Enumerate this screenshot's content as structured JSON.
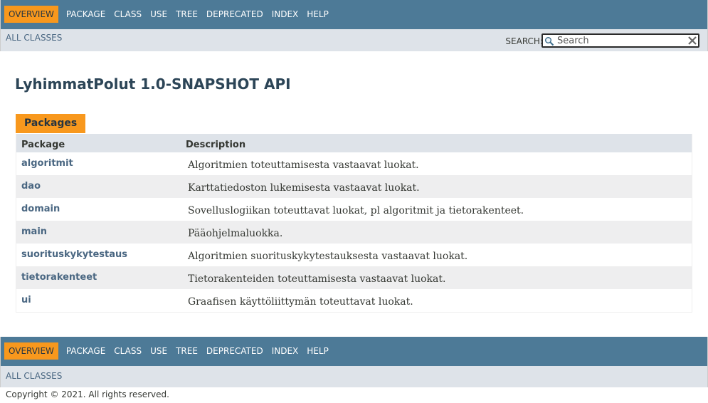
{
  "nav": {
    "items": [
      {
        "label": "Overview",
        "active": true
      },
      {
        "label": "Package",
        "active": false
      },
      {
        "label": "Class",
        "active": false
      },
      {
        "label": "Use",
        "active": false
      },
      {
        "label": "Tree",
        "active": false
      },
      {
        "label": "Deprecated",
        "active": false
      },
      {
        "label": "Index",
        "active": false
      },
      {
        "label": "Help",
        "active": false
      }
    ],
    "all_classes": "All Classes"
  },
  "search": {
    "label": "SEARCH:",
    "placeholder": "Search"
  },
  "page_title": "LyhimmatPolut 1.0-SNAPSHOT API",
  "packages_tab": "Packages",
  "table": {
    "headers": [
      "Package",
      "Description"
    ],
    "rows": [
      {
        "name": "algoritmit",
        "description": "Algoritmien toteuttamisesta vastaavat luokat."
      },
      {
        "name": "dao",
        "description": "Karttatiedoston lukemisesta vastaavat luokat."
      },
      {
        "name": "domain",
        "description": "Sovelluslogiikan toteuttavat luokat, pl algoritmit ja tietorakenteet."
      },
      {
        "name": "main",
        "description": "Pääohjelmaluokka."
      },
      {
        "name": "suorituskykytestaus",
        "description": "Algoritmien suorituskykytestauksesta vastaavat luokat."
      },
      {
        "name": "tietorakenteet",
        "description": "Tietorakenteiden toteuttamisesta vastaavat luokat."
      },
      {
        "name": "ui",
        "description": "Graafisen käyttöliittymän toteuttavat luokat."
      }
    ]
  },
  "copyright": "Copyright © 2021. All rights reserved.",
  "colors": {
    "nav_bg": "#4d7a97",
    "active_tab": "#f8981d",
    "subnav_bg": "#dee3e9",
    "link": "#4a6782",
    "alt_row": "#eeeeef"
  },
  "icons": {
    "search": "search-icon",
    "reset": "reset-icon"
  }
}
